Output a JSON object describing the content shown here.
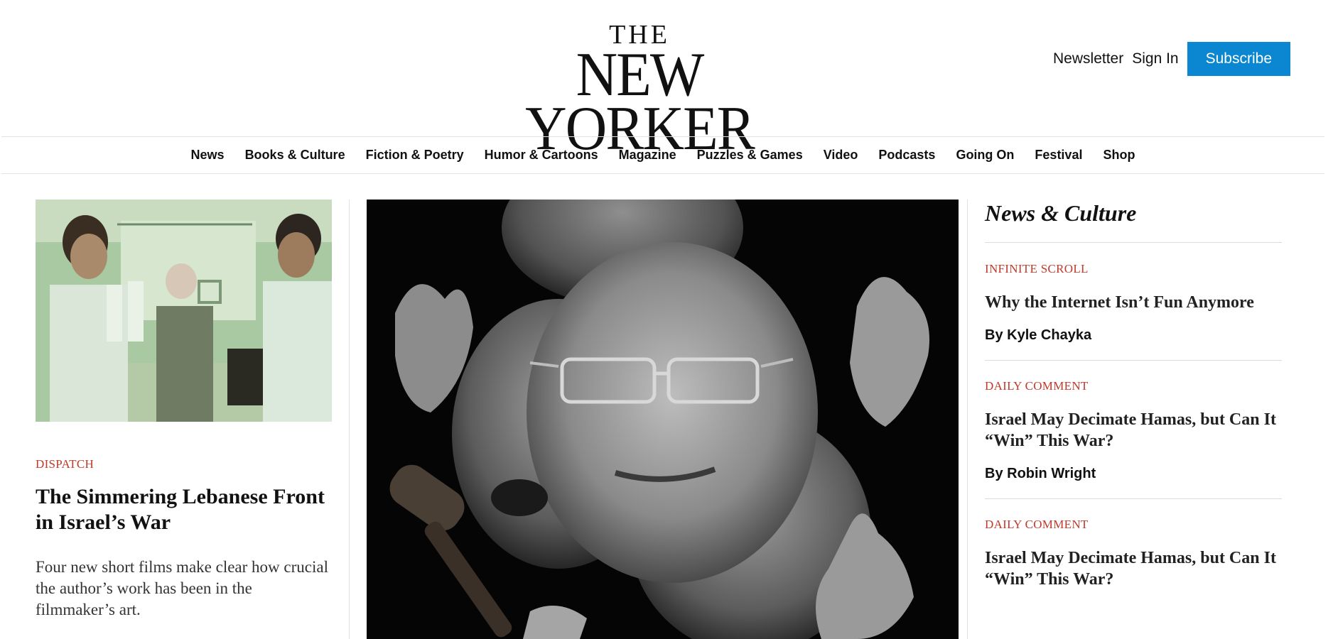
{
  "masthead": {
    "logo_the": "THE",
    "logo_name": "NEW YORKER",
    "newsletter": "Newsletter",
    "sign_in": "Sign In",
    "subscribe": "Subscribe"
  },
  "nav": {
    "items": [
      "News",
      "Books & Culture",
      "Fiction & Poetry",
      "Humor & Cartoons",
      "Magazine",
      "Puzzles & Games",
      "Video",
      "Podcasts",
      "Going On",
      "Festival",
      "Shop"
    ]
  },
  "left_story": {
    "rubric": "DISPATCH",
    "headline": "The Simmering Lebanese Front in Israel’s War",
    "dek": "Four new short films make clear how crucial the author’s work has been in the filmmaker’s art."
  },
  "right_rail": {
    "title": "News & Culture",
    "stories": [
      {
        "rubric": "INFINITE SCROLL",
        "headline": "Why the Internet Isn’t Fun Anymore",
        "byline": "By Kyle Chayka"
      },
      {
        "rubric": "DAILY COMMENT",
        "headline": "Israel May Decimate Hamas, but Can It “Win” This War?",
        "byline": "By Robin Wright"
      },
      {
        "rubric": "DAILY COMMENT",
        "headline": "Israel May Decimate Hamas, but Can It “Win” This War?"
      }
    ]
  },
  "colors": {
    "accent": "#0a87d0",
    "rubric": "#c0392b"
  }
}
